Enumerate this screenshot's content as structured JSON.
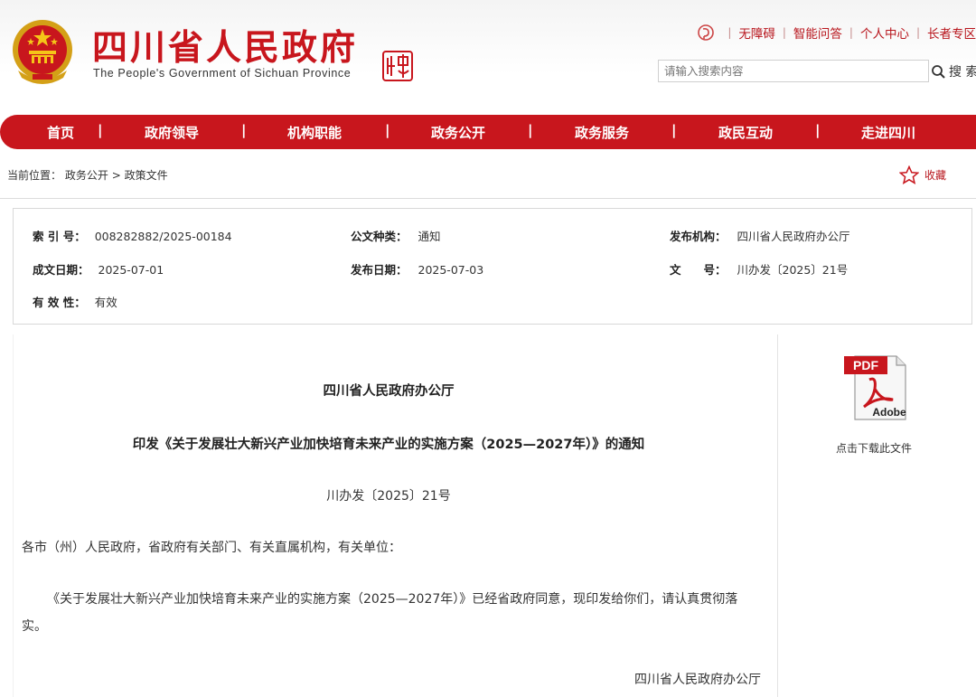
{
  "header": {
    "title": "四川省人民政府",
    "subtitle": "The People's Government of Sichuan Province",
    "seal_icon": "china-seal-icon",
    "top_links": [
      "无障碍",
      "智能问答",
      "个人中心",
      "长者专区"
    ],
    "search_placeholder": "请输入搜索内容",
    "search_label": "搜 索"
  },
  "nav": {
    "items": [
      "首页",
      "政府领导",
      "机构职能",
      "政务公开",
      "政务服务",
      "政民互动",
      "走进四川"
    ],
    "separator": "|",
    "bg_color": "#c8161d"
  },
  "breadcrumb": {
    "label": "当前位置：",
    "path": [
      "政务公开",
      "政策文件"
    ],
    "separator": ">"
  },
  "favorite_label": "收藏",
  "meta": {
    "index_no_label": "索 引 号：",
    "index_no": "008282882/2025-00184",
    "doc_type_label": "公文种类：",
    "doc_type": "通知",
    "publisher_label": "发布机构：",
    "publisher": "四川省人民政府办公厅",
    "written_date_label": "成文日期：",
    "written_date": "2025-07-01",
    "publish_date_label": "发布日期：",
    "publish_date": "2025-07-03",
    "doc_no_label": "文　　号：",
    "doc_no": "川办发〔2025〕21号",
    "validity_label": "有 效 性：",
    "validity": "有效"
  },
  "document": {
    "org": "四川省人民政府办公厅",
    "title": "印发《关于发展壮大新兴产业加快培育未来产业的实施方案（2025—2027年）》的通知",
    "number": "川办发〔2025〕21号",
    "recipients": "各市（州）人民政府，省政府有关部门、有关直属机构，有关单位：",
    "body": "《关于发展壮大新兴产业加快培育未来产业的实施方案（2025—2027年）》已经省政府同意，现印发给你们，请认真贯彻落实。",
    "signature": "四川省人民政府办公厅"
  },
  "download": {
    "pdf_text": "PDF",
    "brand_text": "Adobe",
    "label": "点击下载此文件"
  }
}
